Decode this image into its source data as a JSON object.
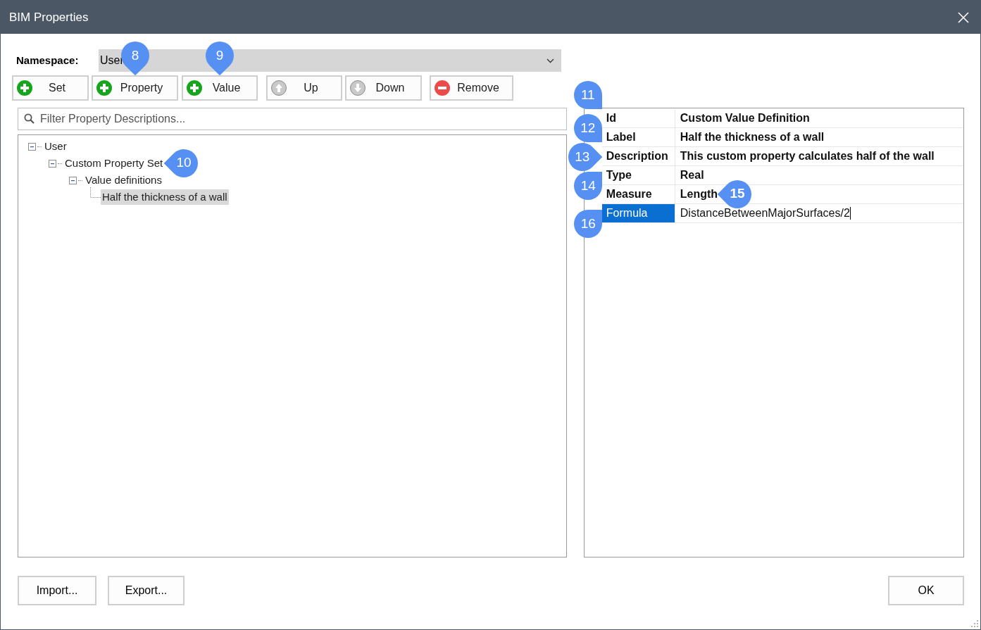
{
  "window": {
    "title": "BIM Properties"
  },
  "namespace": {
    "label": "Namespace:",
    "value": "User"
  },
  "toolbar": [
    {
      "label": "Set"
    },
    {
      "label": "Property",
      "callout": "8"
    },
    {
      "label": "Value",
      "callout": "9"
    },
    {
      "label": "Up"
    },
    {
      "label": "Down"
    },
    {
      "label": "Remove"
    }
  ],
  "filter": {
    "placeholder": "Filter Property Descriptions..."
  },
  "tree": [
    {
      "label": "User",
      "expanded": true,
      "selected": false,
      "children": [
        {
          "label": "Custom Property Set",
          "expanded": true,
          "selected": false,
          "callout": "10",
          "children": [
            {
              "label": "Value definitions",
              "expanded": true,
              "selected": false,
              "children": [
                {
                  "label": "Half the thickness of a wall",
                  "selected": true
                }
              ]
            }
          ]
        }
      ]
    }
  ],
  "properties": [
    {
      "name": "Id",
      "value": "Custom Value Definition",
      "selected": false,
      "callout": "11"
    },
    {
      "name": "Label",
      "value": "Half the thickness of a wall",
      "selected": false,
      "callout": "12"
    },
    {
      "name": "Description",
      "value": "This custom property calculates half of the wall",
      "selected": false,
      "callout": "13"
    },
    {
      "name": "Type",
      "value": "Real",
      "selected": false,
      "callout": "14"
    },
    {
      "name": "Measure",
      "value": "Length",
      "selected": false,
      "callout": "15"
    },
    {
      "name": "Formula",
      "value": "DistanceBetweenMajorSurfaces/2",
      "selected": true,
      "callout": "16"
    }
  ],
  "footer": {
    "buttons": [
      "Import...",
      "Export..."
    ],
    "ok": "OK"
  }
}
